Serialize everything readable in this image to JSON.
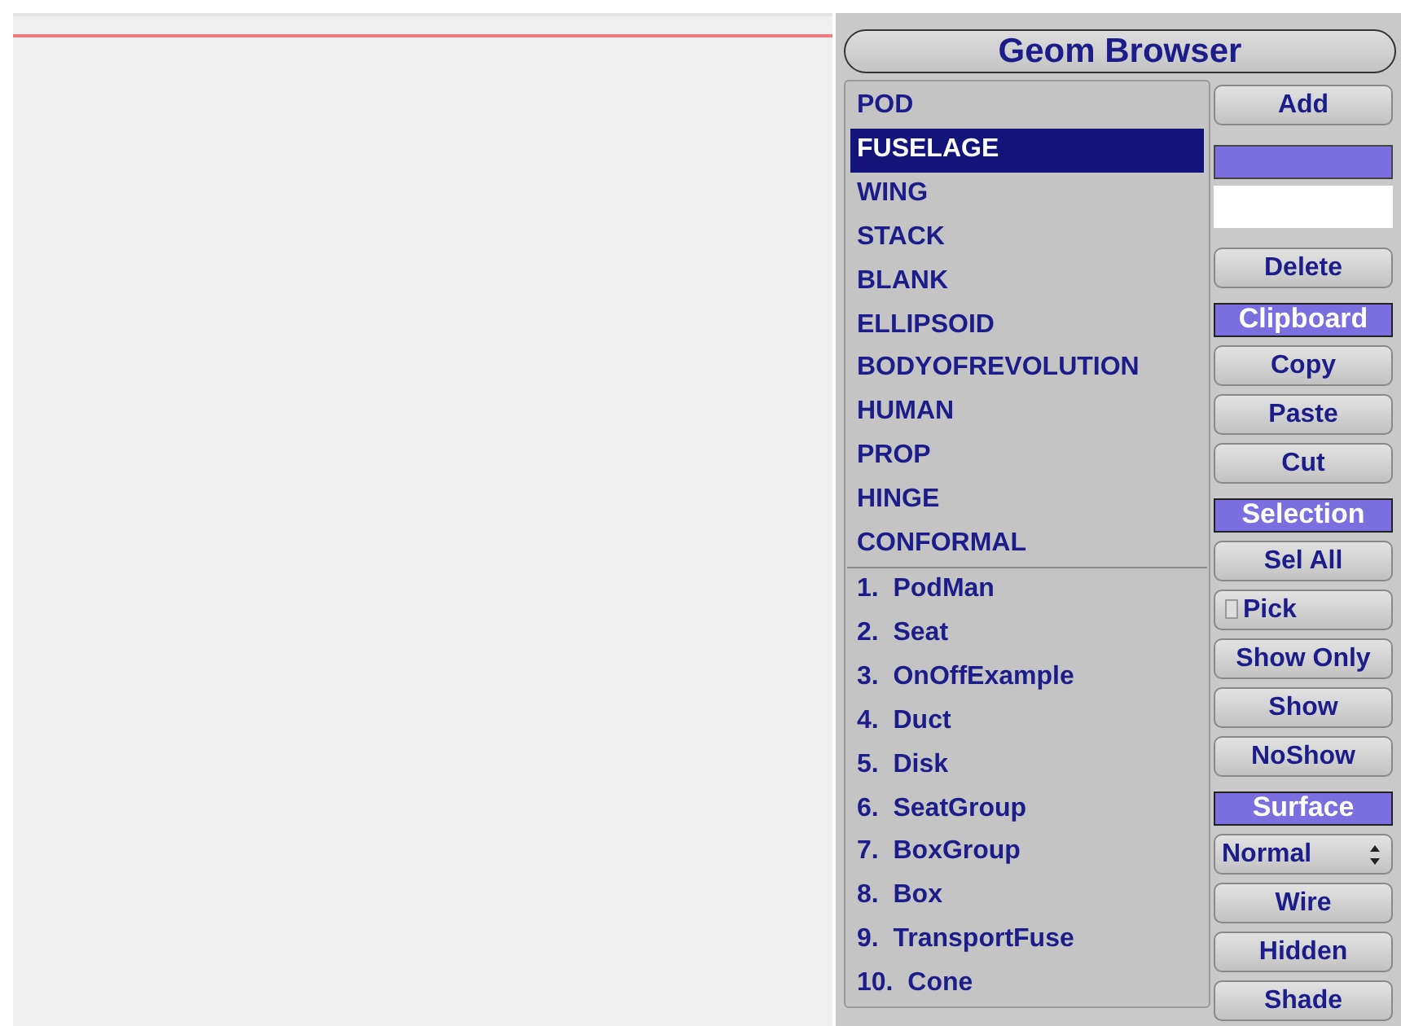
{
  "title": "Geom Browser",
  "geom_types": [
    {
      "label": "POD",
      "selected": false
    },
    {
      "label": "FUSELAGE",
      "selected": true
    },
    {
      "label": "WING",
      "selected": false
    },
    {
      "label": "STACK",
      "selected": false
    },
    {
      "label": "BLANK",
      "selected": false
    },
    {
      "label": "ELLIPSOID",
      "selected": false
    },
    {
      "label": "BODYOFREVOLUTION",
      "selected": false
    },
    {
      "label": "HUMAN",
      "selected": false
    },
    {
      "label": "PROP",
      "selected": false
    },
    {
      "label": "HINGE",
      "selected": false
    },
    {
      "label": "CONFORMAL",
      "selected": false
    }
  ],
  "geoms": [
    "1.  PodMan",
    "2.  Seat",
    "3.  OnOffExample",
    "4.  Duct",
    "5.  Disk",
    "6.  SeatGroup",
    "7.  BoxGroup",
    "8.  Box",
    "9.  TransportFuse",
    "10.  Cone"
  ],
  "controls": [
    {
      "kind": "button",
      "label": "Add"
    },
    {
      "kind": "bar"
    },
    {
      "kind": "field"
    },
    {
      "kind": "button",
      "label": "Delete"
    },
    {
      "kind": "header",
      "label": "Clipboard"
    },
    {
      "kind": "button",
      "label": "Copy"
    },
    {
      "kind": "button",
      "label": "Paste"
    },
    {
      "kind": "button",
      "label": "Cut"
    },
    {
      "kind": "header",
      "label": "Selection"
    },
    {
      "kind": "button",
      "label": "Sel All"
    },
    {
      "kind": "checkbox",
      "label": "Pick",
      "checked": false
    },
    {
      "kind": "button",
      "label": "Show Only"
    },
    {
      "kind": "button",
      "label": "Show"
    },
    {
      "kind": "button",
      "label": "NoShow"
    },
    {
      "kind": "header",
      "label": "Surface"
    },
    {
      "kind": "select",
      "label": "Normal"
    },
    {
      "kind": "button",
      "label": "Wire"
    },
    {
      "kind": "button",
      "label": "Hidden"
    },
    {
      "kind": "button",
      "label": "Shade"
    }
  ]
}
